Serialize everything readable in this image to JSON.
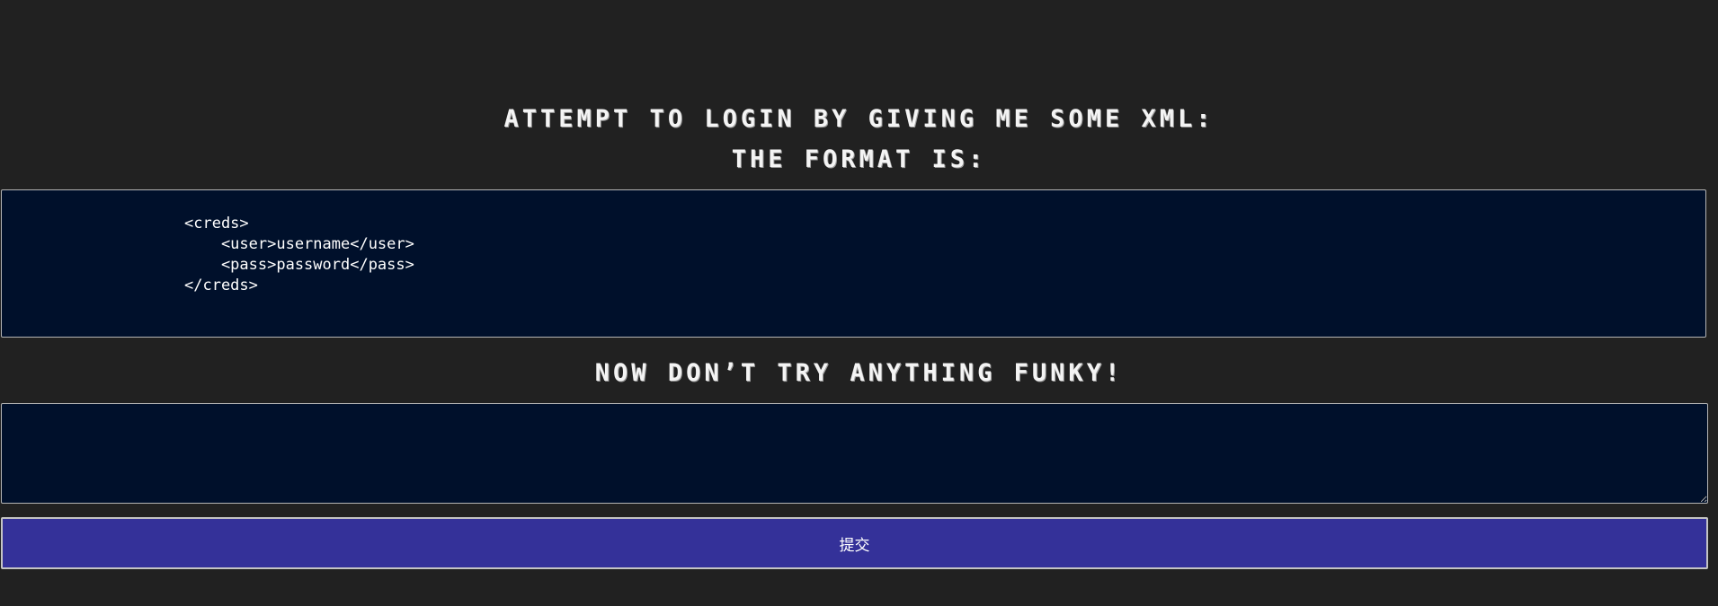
{
  "headings": {
    "intro": "ATTEMPT TO LOGIN BY GIVING ME SOME XML:",
    "format_label": "THE FORMAT IS:",
    "warning": "NOW DON’T TRY ANYTHING FUNKY!"
  },
  "format_example": "<creds>\n    <user>username</user>\n    <pass>password</pass>\n</creds>",
  "xml_input": {
    "value": ""
  },
  "submit": {
    "label": "提交"
  },
  "colors": {
    "background": "#212121",
    "box_background": "#00102b",
    "button": "#343199",
    "border": "#b5b5b5"
  }
}
